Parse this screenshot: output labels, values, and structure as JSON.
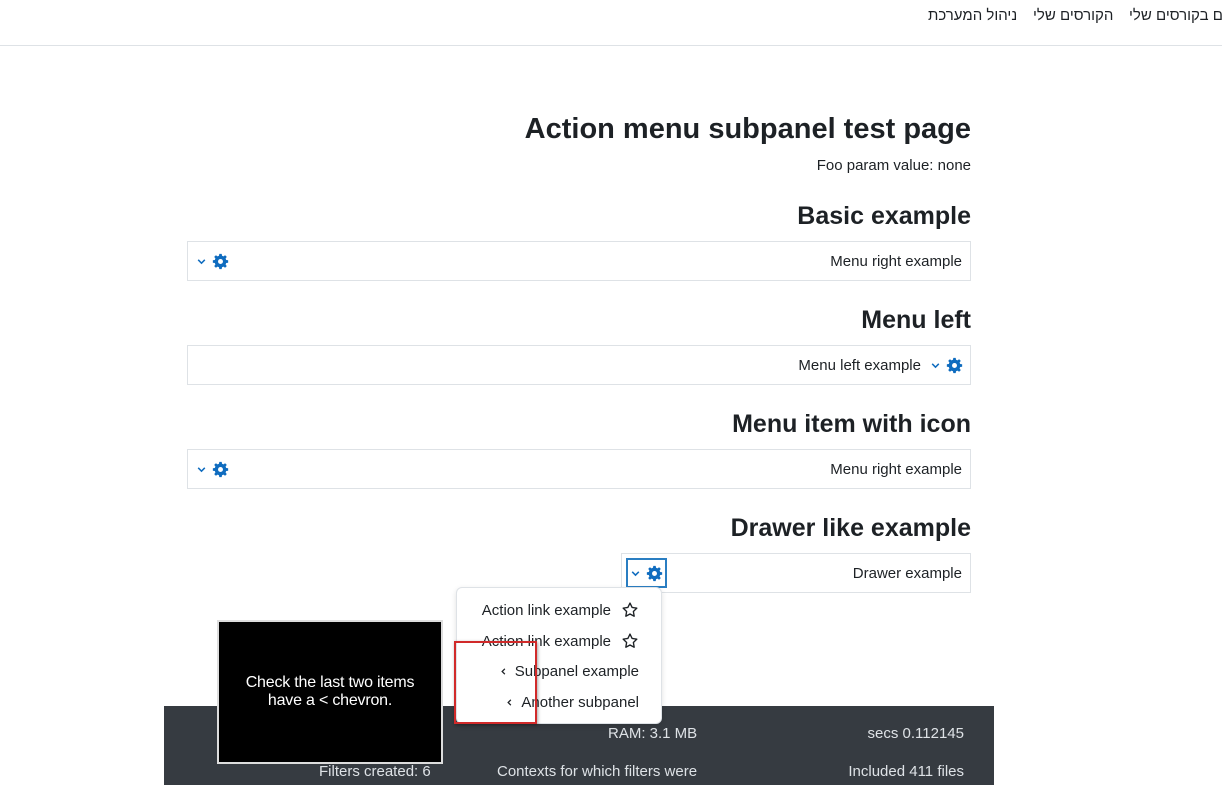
{
  "nav": {
    "items": [
      "ם בקורסים שלי",
      "הקורסים שלי",
      "ניהול המערכת"
    ]
  },
  "page": {
    "title": "Action menu subpanel test page",
    "foo_param": "Foo param value: none"
  },
  "sections": [
    {
      "heading": "Basic example",
      "label": "Menu right example"
    },
    {
      "heading": "Menu left",
      "label": "Menu left example"
    },
    {
      "heading": "Menu item with icon",
      "label": "Menu right example"
    },
    {
      "heading": "Drawer like example",
      "label": "Drawer example"
    }
  ],
  "dropdown": {
    "items": [
      {
        "label": "Action link example",
        "icon": "star-icon"
      },
      {
        "label": "Action link example",
        "icon": "star-icon"
      },
      {
        "label": "Subpanel example",
        "icon": "chevron-left-icon"
      },
      {
        "label": "Another subpanel",
        "icon": "chevron-left-icon"
      }
    ]
  },
  "footer": {
    "ram": "RAM: 3.1 MB",
    "secs": "secs 0.112145",
    "filters": "Filters created: 6",
    "contexts": "Contexts for which filters were",
    "included": "Included 411 files"
  },
  "annotation": {
    "tooltip": "Check the last two items have a < chevron."
  },
  "colors": {
    "accent": "#0f6cbf",
    "focus": "#2a7ec2",
    "footer_bg": "#363b41",
    "highlight": "#d12a2a"
  }
}
